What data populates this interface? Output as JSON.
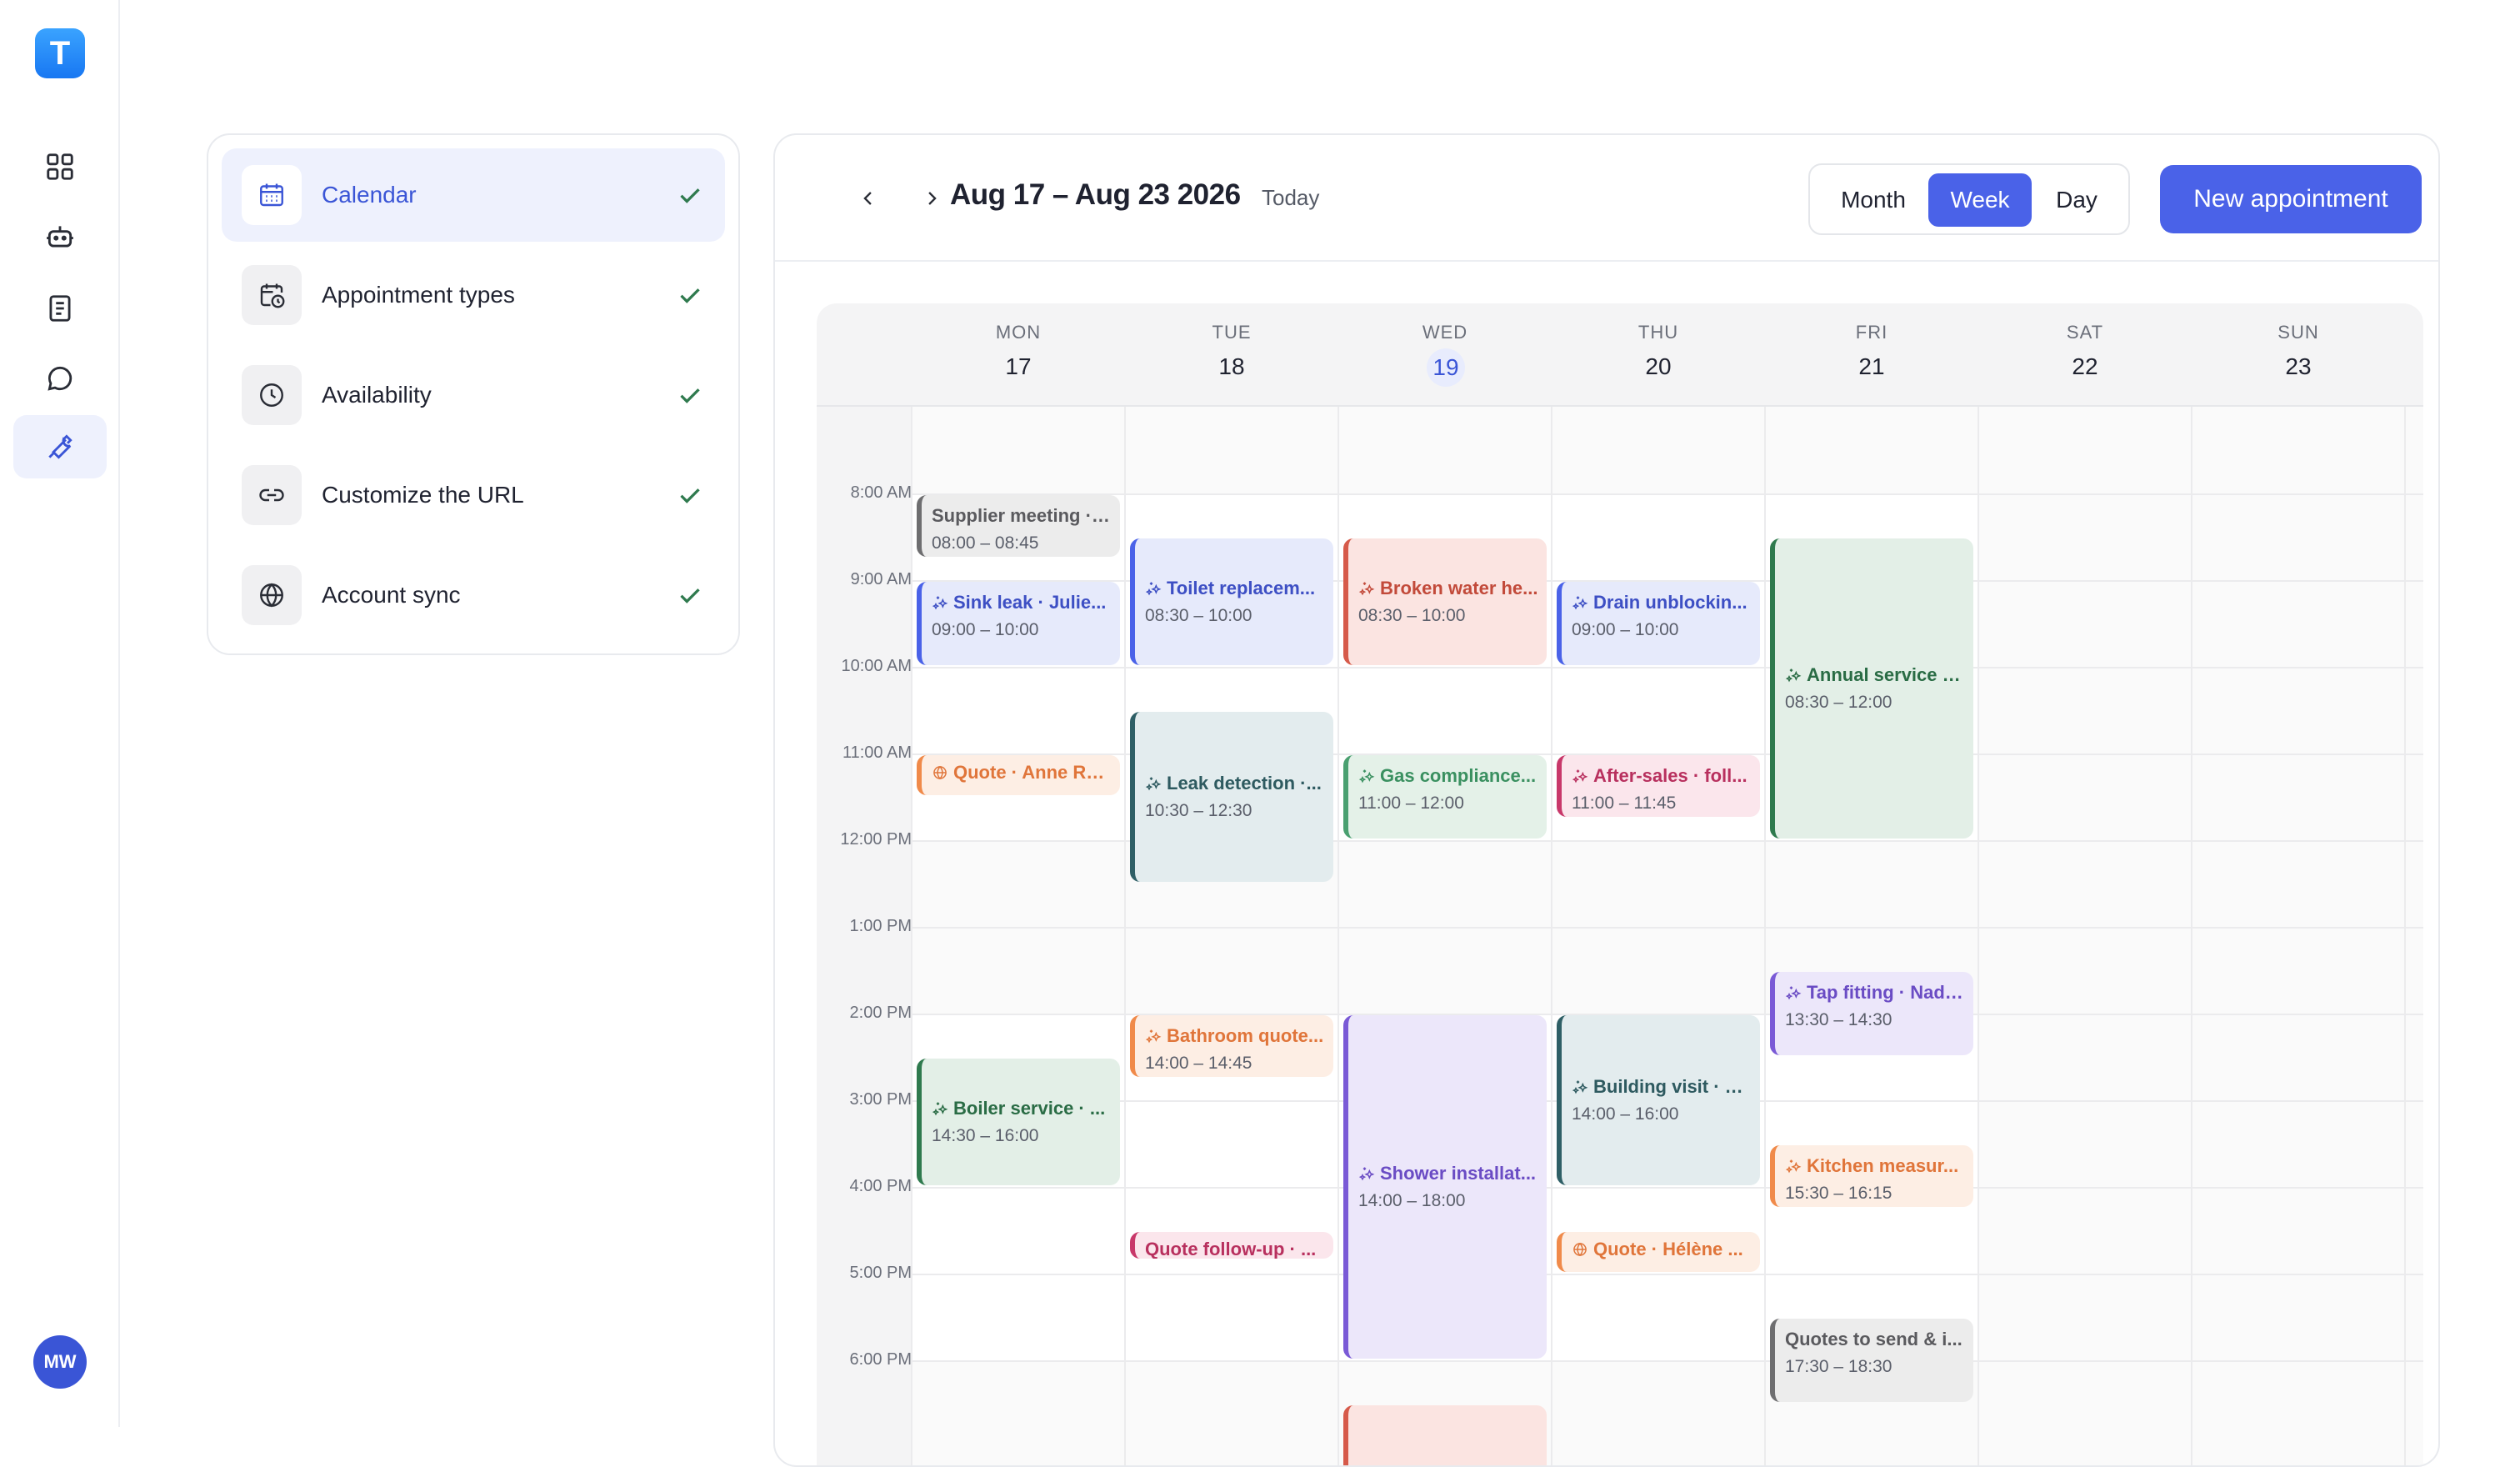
{
  "app": {
    "logo_letter": "T",
    "user_initials": "MW"
  },
  "rail": [
    {
      "name": "dashboard-icon",
      "active": false
    },
    {
      "name": "robot-icon",
      "active": false
    },
    {
      "name": "document-icon",
      "active": false
    },
    {
      "name": "chat-icon",
      "active": false
    },
    {
      "name": "wrench-icon",
      "active": true
    }
  ],
  "settings": {
    "items": [
      {
        "label": "Calendar",
        "icon": "calendar-icon",
        "active": true,
        "done": true
      },
      {
        "label": "Appointment types",
        "icon": "calendar-clock-icon",
        "active": false,
        "done": true
      },
      {
        "label": "Availability",
        "icon": "clock-icon",
        "active": false,
        "done": true
      },
      {
        "label": "Customize the URL",
        "icon": "link-icon",
        "active": false,
        "done": true
      },
      {
        "label": "Account sync",
        "icon": "globe-icon",
        "active": false,
        "done": true
      }
    ]
  },
  "calendar": {
    "range": "Aug 17 – Aug 23 2026",
    "today_label": "Today",
    "views": [
      "Month",
      "Week",
      "Day"
    ],
    "active_view": "Week",
    "new_button": "New appointment",
    "days": [
      {
        "name": "MON",
        "num": "17"
      },
      {
        "name": "TUE",
        "num": "18"
      },
      {
        "name": "WED",
        "num": "19",
        "today": true
      },
      {
        "name": "THU",
        "num": "20"
      },
      {
        "name": "FRI",
        "num": "21"
      },
      {
        "name": "SAT",
        "num": "22"
      },
      {
        "name": "SUN",
        "num": "23"
      }
    ],
    "hours": [
      "8:00 AM",
      "9:00 AM",
      "10:00 AM",
      "11:00 AM",
      "12:00 PM",
      "1:00 PM",
      "2:00 PM",
      "3:00 PM",
      "4:00 PM",
      "5:00 PM",
      "6:00 PM"
    ],
    "events": [
      {
        "day": 0,
        "start": 8.0,
        "end": 8.75,
        "title": "Supplier meeting · ...",
        "time": "08:00 – 08:45",
        "color": "gray",
        "icon": "none"
      },
      {
        "day": 0,
        "start": 9.0,
        "end": 10.0,
        "title": "Sink leak · Julie...",
        "time": "09:00 – 10:00",
        "color": "blue",
        "icon": "sparkle-icon"
      },
      {
        "day": 0,
        "start": 11.0,
        "end": 11.5,
        "title": "Quote · Anne Ro...",
        "time": "",
        "color": "orange",
        "icon": "globe-icon"
      },
      {
        "day": 0,
        "start": 14.5,
        "end": 16.0,
        "title": "Boiler service · ...",
        "time": "14:30 – 16:00",
        "color": "green",
        "icon": "sparkle-icon"
      },
      {
        "day": 1,
        "start": 8.5,
        "end": 10.0,
        "title": "Toilet replacem...",
        "time": "08:30 – 10:00",
        "color": "blue",
        "icon": "sparkle-icon"
      },
      {
        "day": 1,
        "start": 10.5,
        "end": 12.5,
        "title": "Leak detection ·...",
        "time": "10:30 – 12:30",
        "color": "teal",
        "icon": "sparkle-icon"
      },
      {
        "day": 1,
        "start": 14.0,
        "end": 14.75,
        "title": "Bathroom quote...",
        "time": "14:00 – 14:45",
        "color": "orange",
        "icon": "sparkle-icon"
      },
      {
        "day": 1,
        "start": 16.5,
        "end": 16.85,
        "title": "Quote follow-up · ...",
        "time": "",
        "color": "pink",
        "icon": "none"
      },
      {
        "day": 2,
        "start": 8.5,
        "end": 10.0,
        "title": "Broken water he...",
        "time": "08:30 – 10:00",
        "color": "red",
        "icon": "sparkle-icon"
      },
      {
        "day": 2,
        "start": 11.0,
        "end": 12.0,
        "title": "Gas compliance...",
        "time": "11:00 – 12:00",
        "color": "lgreen",
        "icon": "sparkle-icon"
      },
      {
        "day": 2,
        "start": 14.0,
        "end": 18.0,
        "title": "Shower installat...",
        "time": "14:00 – 18:00",
        "color": "purple",
        "icon": "sparkle-icon"
      },
      {
        "day": 2,
        "start": 18.5,
        "end": 19.5,
        "title": "",
        "time": "",
        "color": "red",
        "icon": "none"
      },
      {
        "day": 3,
        "start": 9.0,
        "end": 10.0,
        "title": "Drain unblockin...",
        "time": "09:00 – 10:00",
        "color": "blue",
        "icon": "sparkle-icon"
      },
      {
        "day": 3,
        "start": 11.0,
        "end": 11.75,
        "title": "After-sales · foll...",
        "time": "11:00 – 11:45",
        "color": "pink",
        "icon": "sparkle-icon"
      },
      {
        "day": 3,
        "start": 14.0,
        "end": 16.0,
        "title": "Building visit · S...",
        "time": "14:00 – 16:00",
        "color": "teal",
        "icon": "sparkle-icon"
      },
      {
        "day": 3,
        "start": 16.5,
        "end": 17.0,
        "title": "Quote · Hélène ...",
        "time": "",
        "color": "orange",
        "icon": "globe-icon"
      },
      {
        "day": 4,
        "start": 8.5,
        "end": 12.0,
        "title": "Annual service · ...",
        "time": "08:30 – 12:00",
        "color": "green",
        "icon": "sparkle-icon"
      },
      {
        "day": 4,
        "start": 13.5,
        "end": 14.5,
        "title": "Tap fitting · Nadi...",
        "time": "13:30 – 14:30",
        "color": "purple",
        "icon": "sparkle-icon"
      },
      {
        "day": 4,
        "start": 15.5,
        "end": 16.25,
        "title": "Kitchen measur...",
        "time": "15:30 – 16:15",
        "color": "orange",
        "icon": "sparkle-icon"
      },
      {
        "day": 4,
        "start": 17.5,
        "end": 18.5,
        "title": "Quotes to send & i...",
        "time": "17:30 – 18:30",
        "color": "gray",
        "icon": "none"
      }
    ]
  }
}
